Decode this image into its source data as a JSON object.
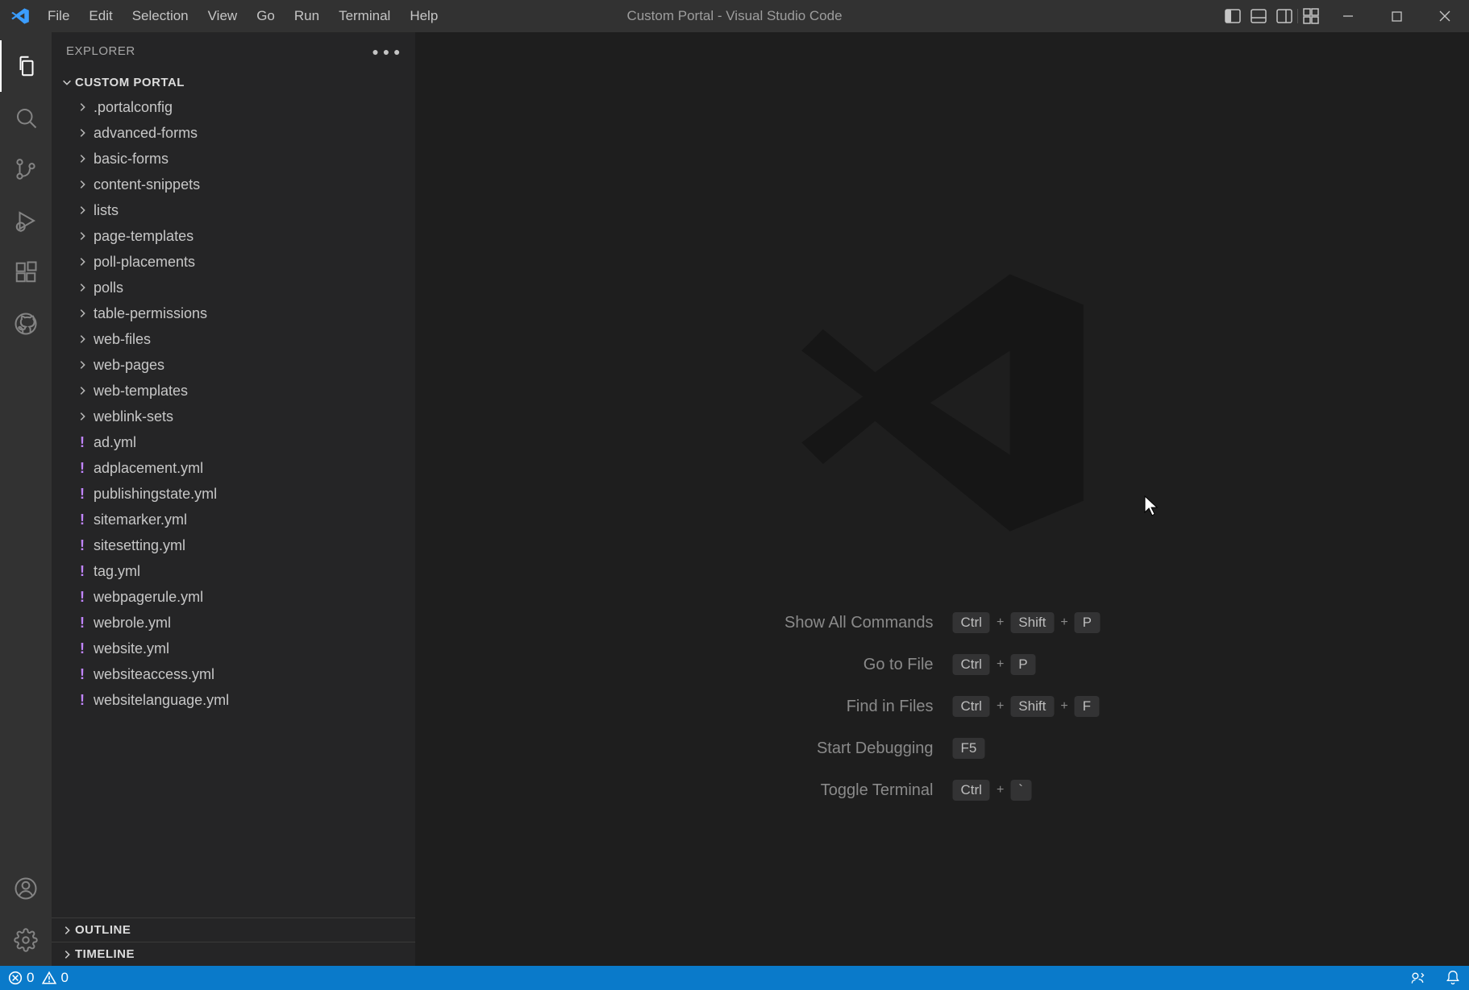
{
  "title": "Custom Portal - Visual Studio Code",
  "menu": [
    "File",
    "Edit",
    "Selection",
    "View",
    "Go",
    "Run",
    "Terminal",
    "Help"
  ],
  "sidebar": {
    "header": "EXPLORER",
    "root": "CUSTOM PORTAL",
    "folders": [
      ".portalconfig",
      "advanced-forms",
      "basic-forms",
      "content-snippets",
      "lists",
      "page-templates",
      "poll-placements",
      "polls",
      "table-permissions",
      "web-files",
      "web-pages",
      "web-templates",
      "weblink-sets"
    ],
    "files": [
      "ad.yml",
      "adplacement.yml",
      "publishingstate.yml",
      "sitemarker.yml",
      "sitesetting.yml",
      "tag.yml",
      "webpagerule.yml",
      "webrole.yml",
      "website.yml",
      "websiteaccess.yml",
      "websitelanguage.yml"
    ],
    "outline": "OUTLINE",
    "timeline": "TIMELINE"
  },
  "shortcuts": [
    {
      "label": "Show All Commands",
      "keys": [
        "Ctrl",
        "+",
        "Shift",
        "+",
        "P"
      ]
    },
    {
      "label": "Go to File",
      "keys": [
        "Ctrl",
        "+",
        "P"
      ]
    },
    {
      "label": "Find in Files",
      "keys": [
        "Ctrl",
        "+",
        "Shift",
        "+",
        "F"
      ]
    },
    {
      "label": "Start Debugging",
      "keys": [
        "F5"
      ]
    },
    {
      "label": "Toggle Terminal",
      "keys": [
        "Ctrl",
        "+",
        "`"
      ]
    }
  ],
  "status": {
    "errors": "0",
    "warnings": "0"
  }
}
